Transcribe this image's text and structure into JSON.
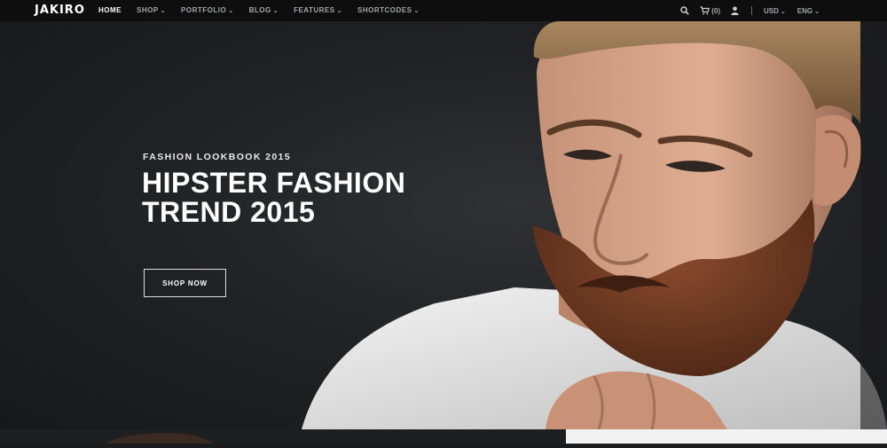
{
  "brand": "JAKIRO",
  "nav": {
    "items": [
      {
        "label": "HOME",
        "active": true,
        "dropdown": false
      },
      {
        "label": "SHOP",
        "active": false,
        "dropdown": true
      },
      {
        "label": "PORTFOLIO",
        "active": false,
        "dropdown": true
      },
      {
        "label": "BLOG",
        "active": false,
        "dropdown": true
      },
      {
        "label": "FEATURES",
        "active": false,
        "dropdown": true
      },
      {
        "label": "SHORTCODES",
        "active": false,
        "dropdown": true
      }
    ],
    "cart_count": "(0)",
    "currency": "USD",
    "language": "ENG",
    "icons": [
      "search-icon",
      "cart-icon",
      "user-icon"
    ]
  },
  "hero": {
    "kicker": "FASHION LOOKBOOK 2015",
    "headline_line1": "HIPSTER FASHION",
    "headline_line2": "TREND 2015",
    "cta": "SHOP NOW"
  },
  "colors": {
    "navbar_bg": "#0e0e0f",
    "hero_bg": "#222326",
    "text_primary": "#ffffff",
    "nav_text": "#a4a6aa"
  }
}
